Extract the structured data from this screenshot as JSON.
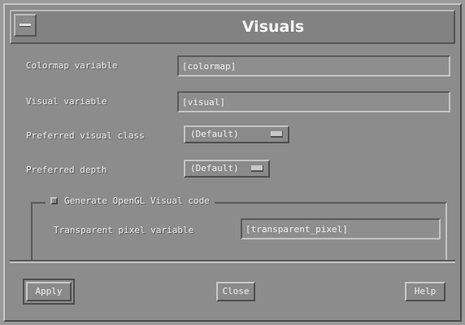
{
  "window": {
    "title": "Visuals"
  },
  "fields": {
    "colormap": {
      "label": "Colormap variable",
      "value": "[colormap]"
    },
    "visual": {
      "label": "Visual variable",
      "value": "[visual]"
    },
    "preferred_class": {
      "label": "Preferred visual class",
      "value": "(Default)"
    },
    "preferred_depth": {
      "label": "Preferred depth",
      "value": "(Default)"
    }
  },
  "opengl": {
    "checkbox_label": "Generate OpenGL Visual code",
    "checked": false,
    "transparent": {
      "label": "Transparent pixel variable",
      "value": "[transparent_pixel]"
    }
  },
  "buttons": {
    "apply": "Apply",
    "close": "Close",
    "help": "Help"
  },
  "icons": {
    "window_menu": "window-menu-icon",
    "option_indicator": "option-menu-indicator-icon"
  }
}
